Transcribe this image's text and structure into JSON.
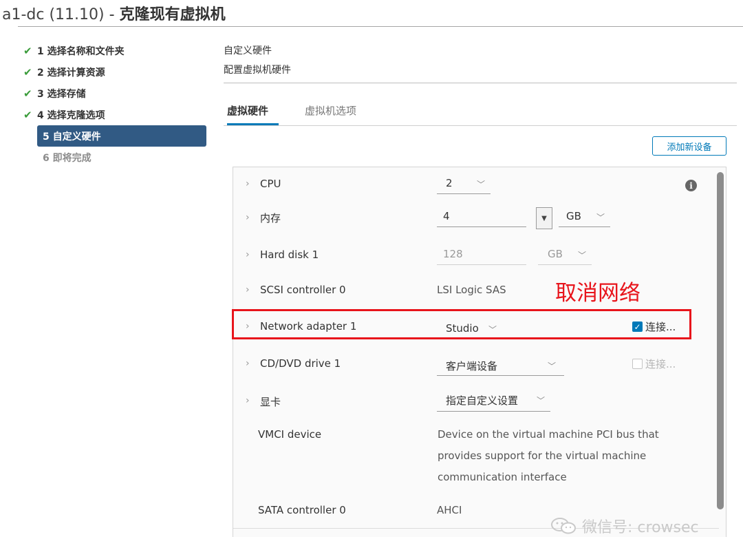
{
  "window": {
    "vm_name": "a1-dc (11.10)",
    "separator": " - ",
    "wizard_title": "克隆现有虚拟机"
  },
  "steps": [
    {
      "label": "1 选择名称和文件夹",
      "state": "done"
    },
    {
      "label": "2 选择计算资源",
      "state": "done"
    },
    {
      "label": "3 选择存储",
      "state": "done"
    },
    {
      "label": "4 选择克隆选项",
      "state": "done"
    },
    {
      "label": "5 自定义硬件",
      "state": "active"
    },
    {
      "label": "6 即将完成",
      "state": "pending"
    }
  ],
  "page": {
    "title": "自定义硬件",
    "subtitle": "配置虚拟机硬件"
  },
  "tabs": [
    {
      "label": "虚拟硬件",
      "active": true
    },
    {
      "label": "虚拟机选项",
      "active": false
    }
  ],
  "add_device_button": "添加新设备",
  "hardware": {
    "cpu": {
      "label": "CPU",
      "value": "2",
      "info_icon": "info-icon"
    },
    "memory": {
      "label": "内存",
      "value": "4",
      "unit": "GB"
    },
    "hard_disk": {
      "label": "Hard disk 1",
      "value": "128",
      "unit": "GB"
    },
    "scsi": {
      "label": "SCSI controller 0",
      "value": "LSI Logic SAS"
    },
    "network": {
      "label": "Network adapter 1",
      "value": "Studio",
      "connect_label": "连接...",
      "connected": true
    },
    "cddvd": {
      "label": "CD/DVD drive 1",
      "value": "客户端设备",
      "connect_label": "连接...",
      "connected": false
    },
    "video": {
      "label": "显卡",
      "value": "指定自定义设置"
    },
    "vmci": {
      "label": "VMCI device",
      "desc_lines": [
        "Device on the virtual machine PCI bus that",
        "provides support for the virtual machine",
        "communication interface"
      ]
    },
    "sata": {
      "label": "SATA controller 0",
      "value": "AHCI"
    }
  },
  "annotation": {
    "text": "取消网络",
    "color": "#e8141b"
  },
  "watermark": "微信号: crowsec",
  "colors": {
    "accent": "#0079b8",
    "active_step_bg": "#315a84",
    "check_green": "#3a9c3a"
  }
}
